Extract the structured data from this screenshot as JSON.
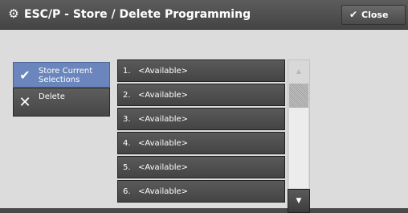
{
  "window": {
    "title": "ESC/P - Store / Delete Programming",
    "title_icon": "gear-icon",
    "close_label": "Close",
    "close_icon": "checkmark-icon"
  },
  "options": [
    {
      "label": "Store Current Selections",
      "icon": "checkmark-icon",
      "selected": true
    },
    {
      "label": "Delete",
      "icon": "x-icon",
      "selected": false
    }
  ],
  "list": {
    "items": [
      {
        "number": "1.",
        "label": "<Available>"
      },
      {
        "number": "2.",
        "label": "<Available>"
      },
      {
        "number": "3.",
        "label": "<Available>"
      },
      {
        "number": "4.",
        "label": "<Available>"
      },
      {
        "number": "5.",
        "label": "<Available>"
      },
      {
        "number": "6.",
        "label": "<Available>"
      }
    ]
  },
  "colors": {
    "selected_option": "#6b86bc",
    "content_background": "#dcdcdc",
    "button_dark": "#4a4a4a"
  }
}
